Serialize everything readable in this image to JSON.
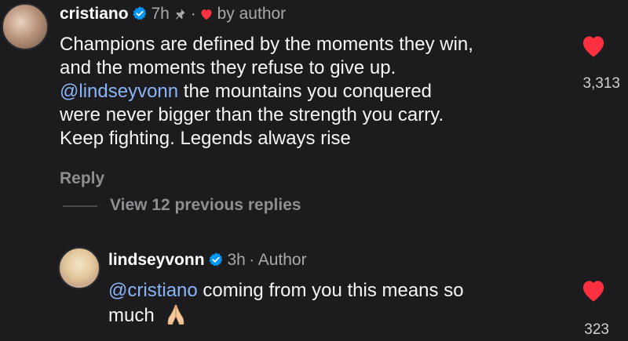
{
  "comments": [
    {
      "username": "cristiano",
      "time": "7h",
      "separator": "·",
      "liked_by_author_label": "by author",
      "lines": [
        "Champions are defined by the moments they win,",
        "and the moments they refuse to give up."
      ],
      "mention": "@lindseyvonn",
      "mention_rest": " the mountains you conquered",
      "lines2": [
        "were never bigger than the strength you carry.",
        "Keep fighting. Legends always rise"
      ],
      "like_count": "3,313",
      "reply_label": "Reply"
    },
    {
      "username": "lindseyvonn",
      "time": "3h",
      "separator": "·",
      "author_label": "Author",
      "mention": "@cristiano",
      "line1_rest": " coming from you this means so",
      "line2": "much",
      "like_count": "323"
    }
  ],
  "view_replies_label": "View 12 previous replies",
  "colors": {
    "background": "#1c1c1e",
    "heart": "#ff3040",
    "verified": "#0095f6",
    "mention": "#8ab4f8"
  },
  "icons": [
    "verified-badge-icon",
    "pin-icon",
    "heart-icon",
    "praying-hands-emoji"
  ]
}
